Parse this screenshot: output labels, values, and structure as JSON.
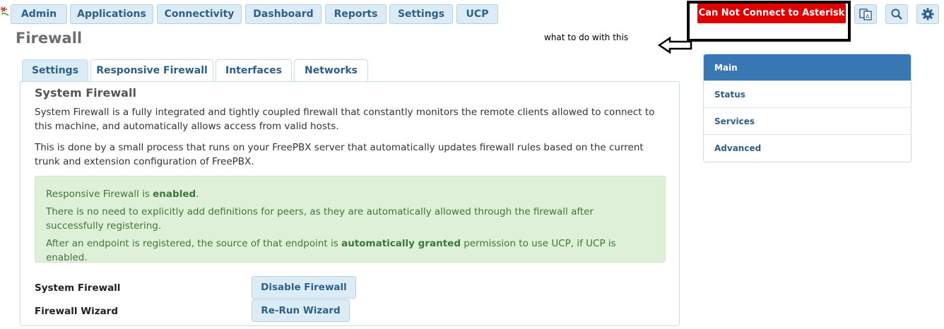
{
  "nav": {
    "items": [
      "Admin",
      "Applications",
      "Connectivity",
      "Dashboard",
      "Reports",
      "Settings",
      "UCP"
    ],
    "alert_label": "Can Not Connect to Asterisk",
    "icons": [
      "translate-icon",
      "search-icon",
      "gear-icon"
    ]
  },
  "annotation": {
    "text": "what to do with this"
  },
  "page": {
    "title": "Firewall"
  },
  "tabs": [
    "Settings",
    "Responsive Firewall",
    "Interfaces",
    "Networks"
  ],
  "section": {
    "title": "System Firewall",
    "para1": "System Firewall is a fully integrated and tightly coupled firewall that constantly monitors the remote clients allowed to connect to this machine, and automatically allows access from valid hosts.",
    "para2": "This is done by a small process that runs on your FreePBX server that automatically updates firewall rules based on the current trunk and extension configuration of FreePBX."
  },
  "notice": {
    "line1_prefix": "Responsive Firewall is ",
    "line1_bold": "enabled",
    "line1_suffix": ".",
    "line2": "There is no need to explicitly add definitions for peers, as they are automatically allowed through the firewall after successfully registering.",
    "line3_prefix": "After an endpoint is registered, the source of that endpoint is ",
    "line3_bold": "automatically granted",
    "line3_suffix": " permission to use UCP, if UCP is enabled."
  },
  "actions": {
    "firewall_label": "System Firewall",
    "firewall_button": "Disable Firewall",
    "wizard_label": "Firewall Wizard",
    "wizard_button": "Re-Run Wizard"
  },
  "side_menu": [
    "Main",
    "Status",
    "Services",
    "Advanced"
  ],
  "colors": {
    "accent": "#3a78b5",
    "alert": "#e00000",
    "success_bg": "#dff0d8",
    "button_bg": "#dcecf7"
  }
}
